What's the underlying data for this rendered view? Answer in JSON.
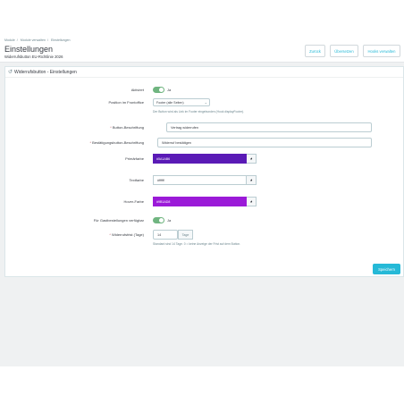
{
  "breadcrumb": [
    "Module",
    "Module verwalten",
    "Einstellungen"
  ],
  "page": {
    "title": "Einstellungen",
    "subtitle": "Widerrufsbutton EU-Richtlinie 2026"
  },
  "header_buttons": {
    "back": "Zurück",
    "translate": "Übersetzen",
    "hooks": "Hooks verwalten"
  },
  "panel": {
    "title": "Widerrufsbutton - Einstellungen",
    "fields": {
      "active": {
        "label": "Aktiviert",
        "value": "Ja"
      },
      "position": {
        "label": "Position im Frontoffice",
        "value": "Footer (alle Seiten)",
        "help": "Der Button wird als Link im Footer eingebunden (Hook displayFooter)."
      },
      "button_label": {
        "label": "Button-Beschriftung",
        "value": "Vertrag widerrufen"
      },
      "confirm_label": {
        "label": "Bestätigungsbutton-Beschriftung",
        "value": "Widerruf bestätigen"
      },
      "primary_color": {
        "label": "Primärfarbe",
        "value": "#5A1AB6"
      },
      "text_color": {
        "label": "Textfarbe",
        "value": "#ffffff"
      },
      "hover_color": {
        "label": "Hover-Farbe",
        "value": "#9B1AD8"
      },
      "guest_orders": {
        "label": "Für Gastbestellungen verfügbar",
        "value": "Ja"
      },
      "withdrawal_period": {
        "label": "Widerrufsfrist (Tage)",
        "value": "14",
        "unit": "Tage",
        "help": "Standard sind 14 Tage. 0 = keine Anzeige der Frist auf dem Button."
      }
    },
    "save": "Speichern"
  },
  "colors": {
    "accent": "#25b9d7",
    "toggle_on": "#70b580",
    "primary_swatch": "#5a1ab6",
    "text_swatch": "#ffffff",
    "hover_swatch": "#9b1ad8"
  },
  "icons": {
    "panel": "refresh-icon",
    "picker": "color-wheel-icon",
    "select": "chevron-down-icon"
  }
}
